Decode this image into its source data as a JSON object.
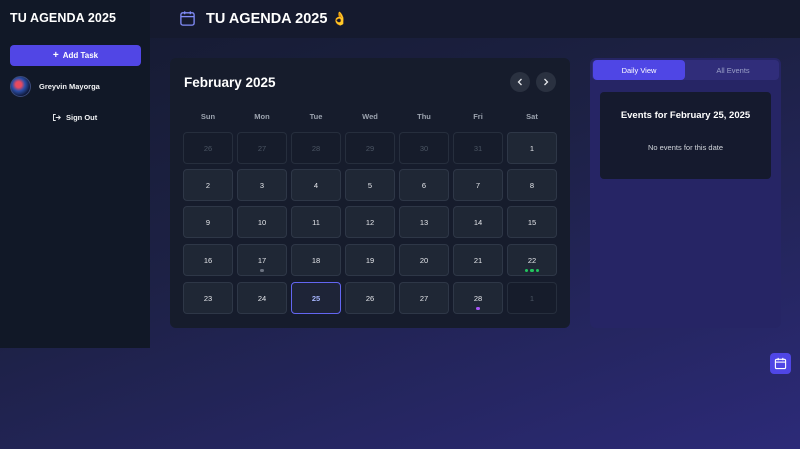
{
  "sidebar": {
    "app_title": "TU AGENDA 2025",
    "add_task_label": "Add Task",
    "user_name": "Greyvin Mayorga",
    "signout_label": "Sign Out"
  },
  "header": {
    "title": "TU AGENDA 2025",
    "emoji": "👌"
  },
  "calendar": {
    "month_title": "February 2025",
    "weekdays": [
      "Sun",
      "Mon",
      "Tue",
      "Wed",
      "Thu",
      "Fri",
      "Sat"
    ],
    "weeks": [
      [
        {
          "d": "26",
          "other": true
        },
        {
          "d": "27",
          "other": true
        },
        {
          "d": "28",
          "other": true
        },
        {
          "d": "29",
          "other": true
        },
        {
          "d": "30",
          "other": true
        },
        {
          "d": "31",
          "other": true
        },
        {
          "d": "1"
        }
      ],
      [
        {
          "d": "2"
        },
        {
          "d": "3"
        },
        {
          "d": "4"
        },
        {
          "d": "5"
        },
        {
          "d": "6"
        },
        {
          "d": "7"
        },
        {
          "d": "8"
        }
      ],
      [
        {
          "d": "9"
        },
        {
          "d": "10"
        },
        {
          "d": "11"
        },
        {
          "d": "12"
        },
        {
          "d": "13"
        },
        {
          "d": "14"
        },
        {
          "d": "15"
        }
      ],
      [
        {
          "d": "16"
        },
        {
          "d": "17",
          "dots": [
            "#6b7280"
          ]
        },
        {
          "d": "18"
        },
        {
          "d": "19"
        },
        {
          "d": "20"
        },
        {
          "d": "21"
        },
        {
          "d": "22",
          "dots": [
            "#22c55e",
            "#22c55e",
            "#22c55e"
          ]
        }
      ],
      [
        {
          "d": "23"
        },
        {
          "d": "24"
        },
        {
          "d": "25",
          "today": true
        },
        {
          "d": "26"
        },
        {
          "d": "27"
        },
        {
          "d": "28",
          "dots": [
            "#a855f7"
          ]
        },
        {
          "d": "1",
          "other": true
        }
      ]
    ]
  },
  "events": {
    "tabs": [
      "Daily View",
      "All Events"
    ],
    "active_tab": "Daily View",
    "title": "Events for February 25, 2025",
    "empty_message": "No events for this date"
  },
  "colors": {
    "accent": "#4f46e5",
    "today_border": "#6366f1"
  }
}
